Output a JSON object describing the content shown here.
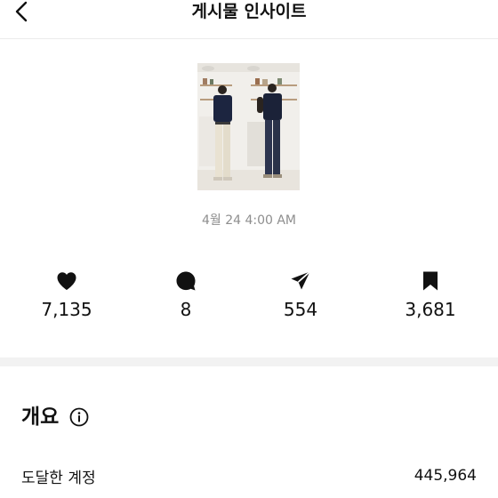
{
  "header": {
    "title": "게시물 인사이트",
    "back_icon": "chevron-left-icon"
  },
  "post": {
    "timestamp": "4월 24 4:00 AM"
  },
  "stats": [
    {
      "icon": "heart-icon",
      "value": "7,135"
    },
    {
      "icon": "comment-icon",
      "value": "8"
    },
    {
      "icon": "share-icon",
      "value": "554"
    },
    {
      "icon": "bookmark-icon",
      "value": "3,681"
    }
  ],
  "overview": {
    "title": "개요",
    "info_icon": "info-icon",
    "rows": [
      {
        "label": "도달한 계정",
        "value": "445,964"
      }
    ]
  },
  "colors": {
    "text": "#111111",
    "muted": "#8e8e8e",
    "divider": "#f2f2f2"
  }
}
